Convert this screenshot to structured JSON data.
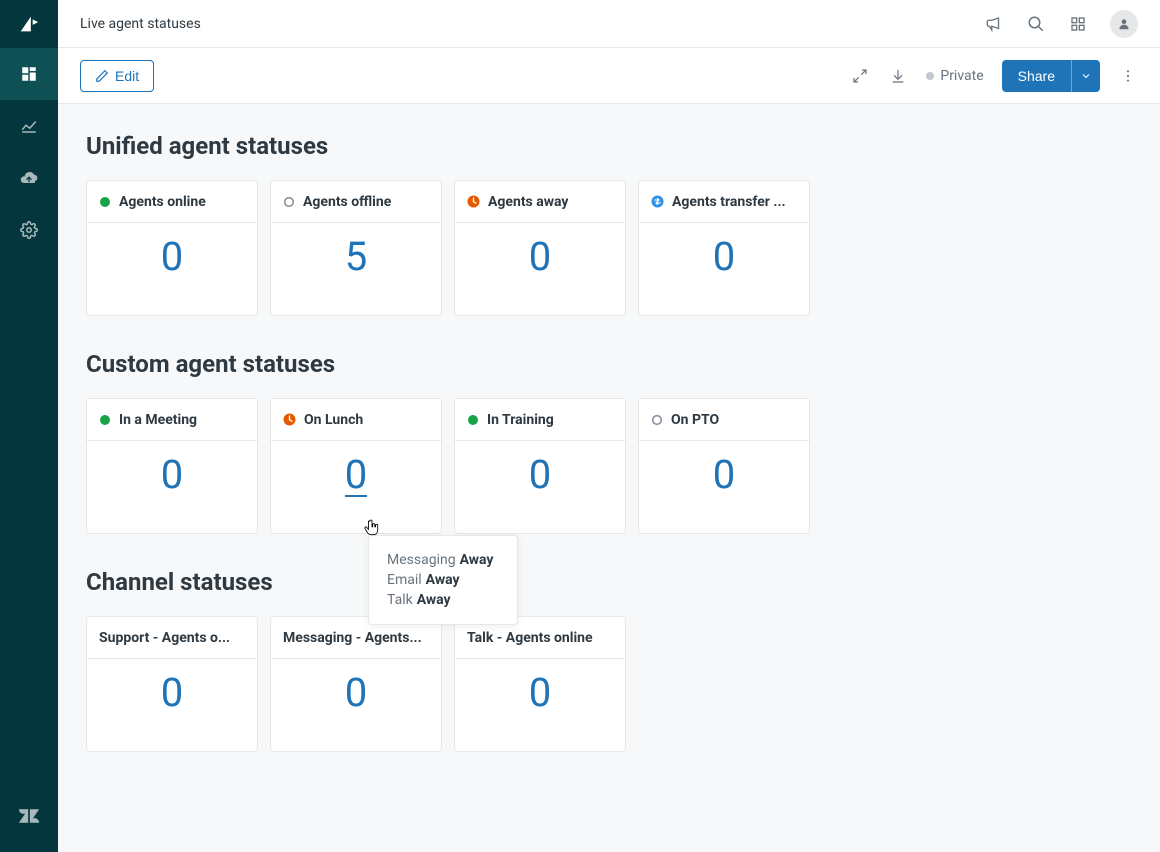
{
  "topbar": {
    "title": "Live agent statuses"
  },
  "toolbar": {
    "edit_label": "Edit",
    "private_label": "Private",
    "share_label": "Share"
  },
  "sections": {
    "unified": {
      "title": "Unified agent statuses",
      "cards": [
        {
          "label": "Agents online",
          "value": "0",
          "icon_color": "#16a34a",
          "icon_type": "solid"
        },
        {
          "label": "Agents offline",
          "value": "5",
          "icon_color": "#87929d",
          "icon_type": "ring"
        },
        {
          "label": "Agents away",
          "value": "0",
          "icon_color": "#e35b00",
          "icon_type": "clock"
        },
        {
          "label": "Agents transfer ...",
          "value": "0",
          "icon_color": "#3093e8",
          "icon_type": "transfer"
        }
      ]
    },
    "custom": {
      "title": "Custom agent statuses",
      "cards": [
        {
          "label": "In a Meeting",
          "value": "0",
          "icon_color": "#16a34a",
          "icon_type": "solid"
        },
        {
          "label": "On Lunch",
          "value": "0",
          "icon_color": "#e35b00",
          "icon_type": "clock",
          "hovered": true
        },
        {
          "label": "In Training",
          "value": "0",
          "icon_color": "#16a34a",
          "icon_type": "solid"
        },
        {
          "label": "On PTO",
          "value": "0",
          "icon_color": "#87929d",
          "icon_type": "ring"
        }
      ]
    },
    "channel": {
      "title": "Channel statuses",
      "cards": [
        {
          "label": "Support - Agents o...",
          "value": "0"
        },
        {
          "label": "Messaging - Agents...",
          "value": "0"
        },
        {
          "label": "Talk - Agents online",
          "value": "0"
        }
      ]
    }
  },
  "tooltip": {
    "rows": [
      {
        "channel": "Messaging",
        "status": "Away"
      },
      {
        "channel": "Email",
        "status": "Away"
      },
      {
        "channel": "Talk",
        "status": "Away"
      }
    ]
  }
}
